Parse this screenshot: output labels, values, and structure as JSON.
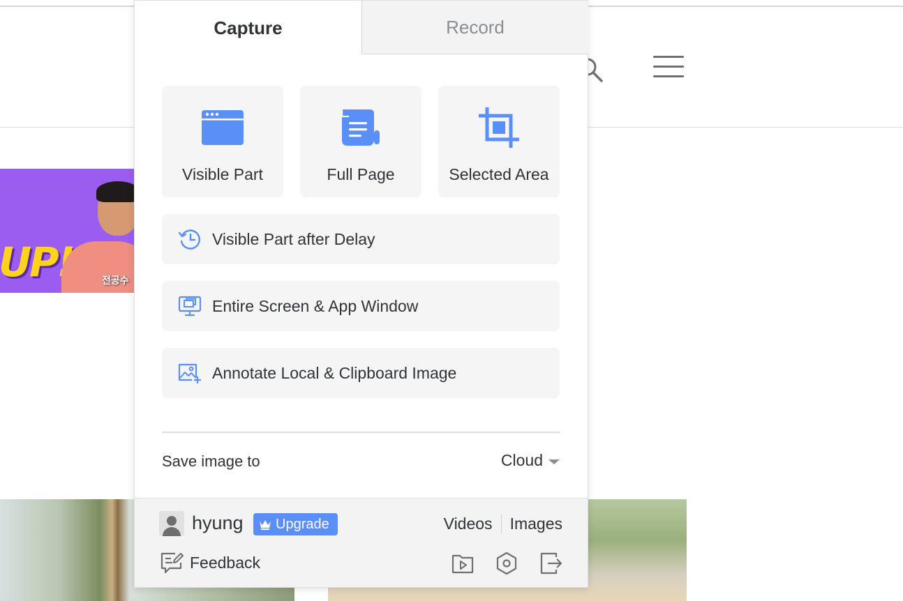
{
  "tabs": {
    "capture": "Capture",
    "record": "Record"
  },
  "capture_tiles": [
    {
      "label": "Visible Part",
      "icon": "browser-window-icon"
    },
    {
      "label": "Full Page",
      "icon": "scroll-page-icon"
    },
    {
      "label": "Selected Area",
      "icon": "crop-icon"
    }
  ],
  "capture_rows": [
    {
      "label": "Visible Part after Delay",
      "icon": "delay-clock-icon"
    },
    {
      "label": "Entire Screen & App Window",
      "icon": "screen-windows-icon"
    },
    {
      "label": "Annotate Local & Clipboard Image",
      "icon": "image-add-icon"
    }
  ],
  "save": {
    "label": "Save image to",
    "value": "Cloud"
  },
  "footer": {
    "username": "hyung",
    "upgrade_label": "Upgrade",
    "links": {
      "videos": "Videos",
      "images": "Images"
    },
    "feedback_label": "Feedback",
    "icons": [
      "video-library-icon",
      "settings-hex-icon",
      "logout-icon"
    ]
  },
  "background": {
    "banner_text": "UP!",
    "banner_caption": "전공수"
  },
  "colors": {
    "accent": "#5a8ff7",
    "tile_bg": "#f5f5f5",
    "footer_bg": "#f3f3f3",
    "text": "#2f3237",
    "muted": "#8a8d93"
  }
}
